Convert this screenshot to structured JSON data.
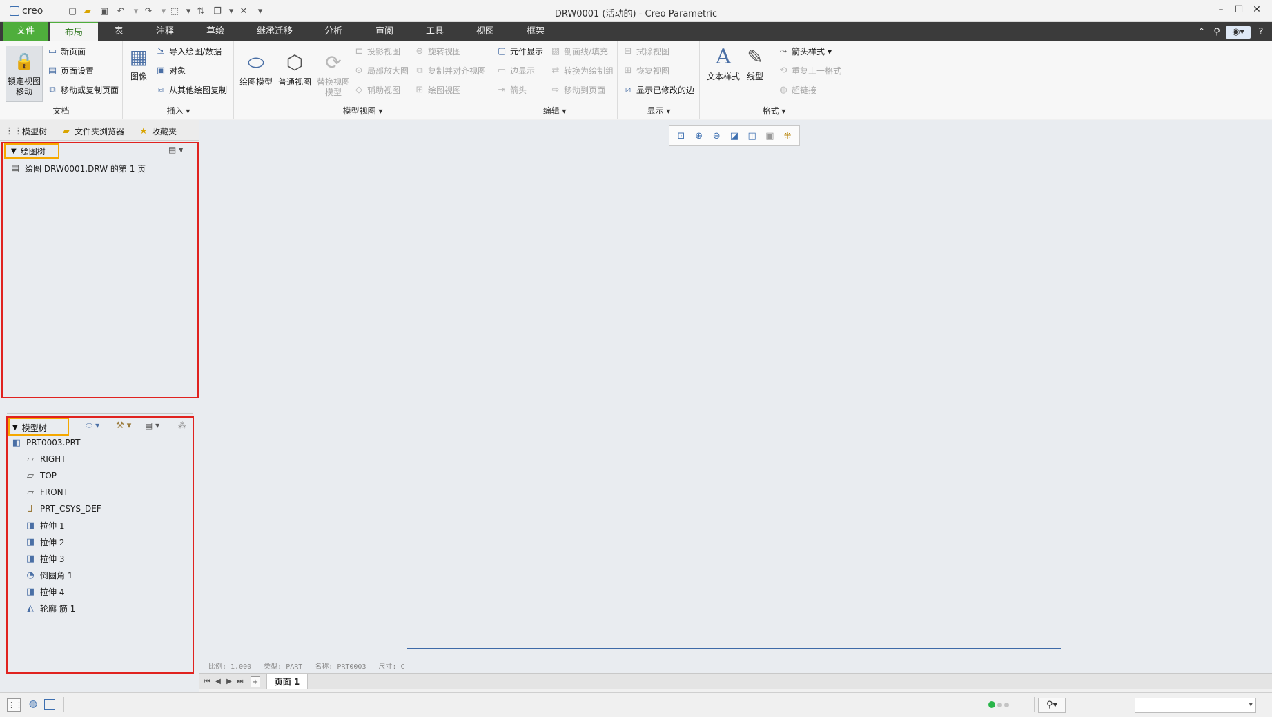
{
  "app": {
    "logo_text": "creo",
    "window_title": "DRW0001 (活动的) - Creo Parametric"
  },
  "tabs": [
    "文件",
    "布局",
    "表",
    "注释",
    "草绘",
    "继承迁移",
    "分析",
    "审阅",
    "工具",
    "视图",
    "框架"
  ],
  "ribbon": {
    "doc": {
      "lock_view_move": "锁定视图\n移动",
      "new_page": "新页面",
      "page_setup": "页面设置",
      "move_copy_page": "移动或复制页面",
      "label": "文档"
    },
    "insert": {
      "image": "图像",
      "import_drawing": "导入绘图/数据",
      "object": "对象",
      "copy_from_other": "从其他绘图复制",
      "label": "插入"
    },
    "model_views": {
      "drawing_model": "绘图模型",
      "general_view": "普通视图",
      "replace_view_model_1": "替换视图",
      "replace_view_model_2": "模型",
      "projection_view": "投影视图",
      "detailed_view": "局部放大图",
      "auxiliary_view": "辅助视图",
      "revolved_view": "旋转视图",
      "copy_align_view": "复制并对齐视图",
      "drawing_view": "绘图视图",
      "label": "模型视图"
    },
    "edit": {
      "component_display": "元件显示",
      "edge_display": "边显示",
      "arrow": "箭头",
      "section_fill": "剖面线/填充",
      "convert_draw_group": "转换为绘制组",
      "move_to_page": "移动到页面",
      "label": "编辑"
    },
    "display": {
      "erase_view": "拭除视图",
      "resume_view": "恢复视图",
      "show_modified_edges": "显示已修改的边",
      "label": "显示"
    },
    "format": {
      "text_style": "文本样式",
      "line_style": "线型",
      "arrow_style": "箭头样式",
      "repeat_format": "重复上一格式",
      "hyperlink": "超链接",
      "label": "格式"
    }
  },
  "nav_tabs": [
    "模型树",
    "文件夹浏览器",
    "收藏夹"
  ],
  "drawing_tree": {
    "title": "绘图树",
    "item": "绘图 DRW0001.DRW 的第 1 页"
  },
  "model_tree": {
    "title": "模型树",
    "root": "PRT0003.PRT",
    "items": [
      "RIGHT",
      "TOP",
      "FRONT",
      "PRT_CSYS_DEF",
      "拉伸 1",
      "拉伸 2",
      "拉伸 3",
      "倒圆角 1",
      "拉伸 4",
      "轮廓 筋 1"
    ]
  },
  "status_info": [
    "比例: 1.000",
    "类型: PART",
    "名称: PRT0003",
    "尺寸: C"
  ],
  "page_tab": "页面 1",
  "colors": {
    "accent_green": "#4fae3c",
    "sheet_border": "#3e6aa8",
    "highlight_red": "#e0221f",
    "highlight_orange": "#f5a800"
  }
}
